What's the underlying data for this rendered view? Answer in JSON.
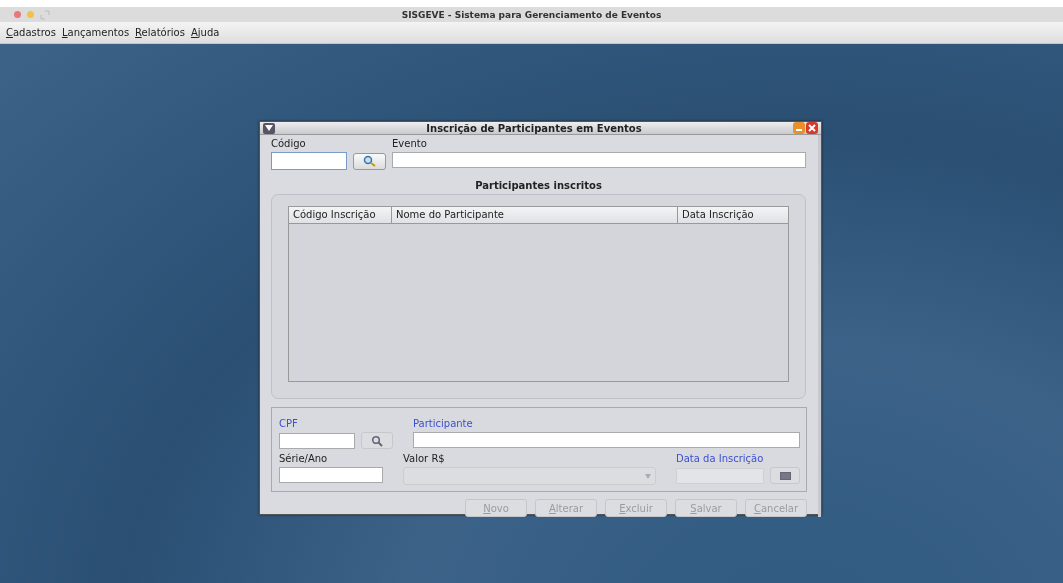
{
  "app_window": {
    "title": "SISGEVE - Sistema para Gerenciamento de Eventos"
  },
  "menu": [
    {
      "label": "Cadastros"
    },
    {
      "label": "Lançamentos"
    },
    {
      "label": "Relatórios"
    },
    {
      "label": "Ajuda"
    }
  ],
  "dialog": {
    "title": "Inscrição de Participantes em Eventos",
    "codigo": {
      "label": "Código",
      "focused": true
    },
    "evento": {
      "label": "Evento"
    },
    "participants_panel": {
      "title": "Participantes inscritos",
      "columns": [
        "Código Inscrição",
        "Nome do Participante",
        "Data Inscrição"
      ]
    },
    "form": {
      "cpf": {
        "label": "CPF",
        "required": true
      },
      "participante": {
        "label": "Participante",
        "required": true
      },
      "serie": {
        "label": "Série/Ano",
        "required": false
      },
      "valor": {
        "label": "Valor R$",
        "required": false,
        "disabled": true
      },
      "data": {
        "label": "Data da Inscrição",
        "required": true,
        "disabled": true
      }
    },
    "buttons": [
      {
        "label": "Novo",
        "disabled": true
      },
      {
        "label": "Alterar",
        "disabled": true
      },
      {
        "label": "Excluir",
        "disabled": true
      },
      {
        "label": "Salvar",
        "disabled": true
      },
      {
        "label": "Cancelar",
        "disabled": true
      }
    ]
  }
}
